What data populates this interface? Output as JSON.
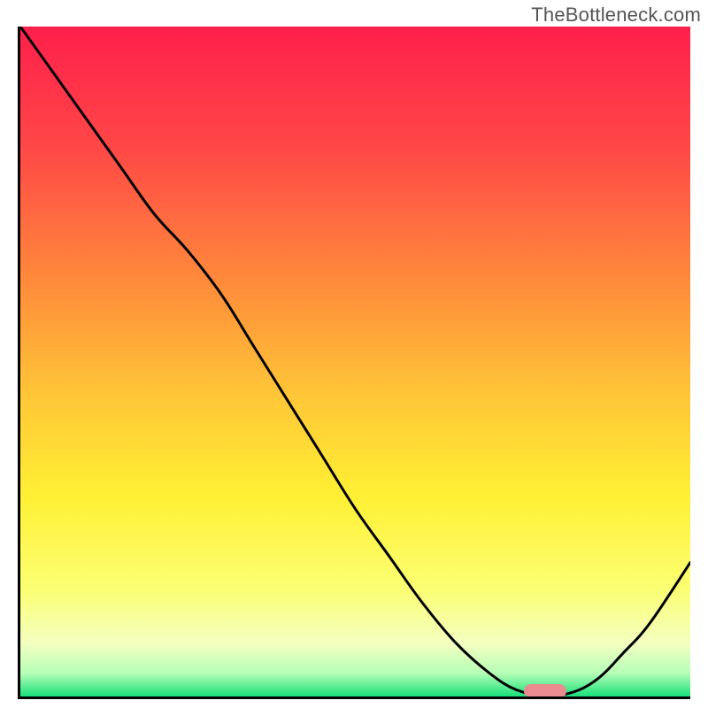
{
  "watermark": "TheBottleneck.com",
  "chart_data": {
    "type": "line",
    "title": "",
    "xlabel": "",
    "ylabel": "",
    "xlim": [
      0,
      100
    ],
    "ylim": [
      0,
      100
    ],
    "gradient_stops": [
      {
        "pos": 0.0,
        "color": "#ff1f4b"
      },
      {
        "pos": 0.18,
        "color": "#ff4747"
      },
      {
        "pos": 0.38,
        "color": "#ff8a3a"
      },
      {
        "pos": 0.55,
        "color": "#ffc637"
      },
      {
        "pos": 0.7,
        "color": "#fff033"
      },
      {
        "pos": 0.84,
        "color": "#fbff73"
      },
      {
        "pos": 0.92,
        "color": "#f4ffc0"
      },
      {
        "pos": 0.965,
        "color": "#b7ffb7"
      },
      {
        "pos": 1.0,
        "color": "#18e07a"
      }
    ],
    "series": [
      {
        "name": "bottleneck-curve",
        "x": [
          0,
          5,
          10,
          15,
          20,
          25,
          30,
          35,
          40,
          45,
          50,
          55,
          60,
          65,
          70,
          74,
          78,
          82,
          86,
          90,
          94,
          100
        ],
        "y": [
          100,
          93,
          86,
          79,
          72,
          66.5,
          60,
          52,
          44,
          36,
          28,
          21,
          14,
          8,
          3.5,
          1.0,
          0.2,
          0.5,
          2.5,
          6.5,
          11,
          20
        ]
      }
    ],
    "marker": {
      "x": 78,
      "y": 1.2,
      "color": "#e98b8f"
    }
  }
}
